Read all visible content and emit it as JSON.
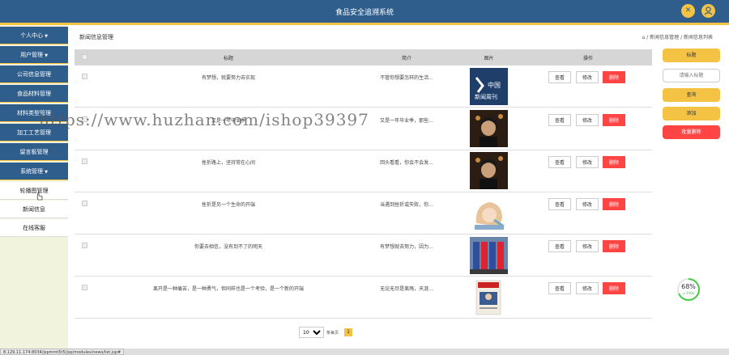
{
  "header": {
    "title": "食品安全追溯系统"
  },
  "sidebar": {
    "menu": [
      {
        "label": "个人中心",
        "caret": true
      },
      {
        "label": "用户管理",
        "caret": true
      },
      {
        "label": "公司信息管理",
        "caret": false
      },
      {
        "label": "食品材料管理",
        "caret": false
      },
      {
        "label": "材料类型管理",
        "caret": false
      },
      {
        "label": "加工工艺管理",
        "caret": false
      },
      {
        "label": "留言板管理",
        "caret": false
      },
      {
        "label": "系统管理",
        "caret": true
      }
    ],
    "submenu": [
      {
        "label": "轮播图管理"
      },
      {
        "label": "新闻信息"
      },
      {
        "label": "在线客服"
      }
    ]
  },
  "breadcrumb": {
    "page_title": "新闻信息管理",
    "path": "/ 新闻信息管理 / 新闻信息列表"
  },
  "table": {
    "columns": {
      "title": "标题",
      "intro": "简介",
      "image": "图片",
      "actions": "操作"
    },
    "rows": [
      {
        "title": "有梦想，就要努力去实现",
        "intro": "不管你想要怎样的生活...",
        "image": "magazine-cover"
      },
      {
        "title": "又是一年毕业季",
        "intro": "又是一年毕业季，那些...",
        "image": "portrait-dark"
      },
      {
        "title": "挫折路上，坚持常在心间",
        "intro": "回头看看，你会不会发...",
        "image": "portrait-dark"
      },
      {
        "title": "挫折是另一个生命的开端",
        "intro": "当遇到挫折或失败，你...",
        "image": "cartoon-girl"
      },
      {
        "title": "你要去相信，没有到不了的明天",
        "intro": "有梦想就去努力，因为...",
        "image": "flags"
      },
      {
        "title": "离开是一种痛苦，是一种勇气，但同样也是一个考验，是一个新的开端",
        "intro": "无论无尽是离殇，天涯...",
        "image": "book-cover"
      }
    ],
    "actions": {
      "view": "查看",
      "edit": "修改",
      "delete": "删除"
    }
  },
  "right_panel": {
    "title_button": "标题",
    "search_placeholder": "请输入标题",
    "query": "查询",
    "add": "添加",
    "batch_delete": "批量删除"
  },
  "pager": {
    "page_size": "10",
    "label": "条每页",
    "current_page": "1"
  },
  "progress": {
    "value": "68%",
    "sub": "↓ 0 K/s",
    "fraction": 0.68
  },
  "statusbar": {
    "url": "8.129.11.174:8034/jspmmt5t5/jsp/modules/news/list.jsp#"
  },
  "watermark": {
    "text": "https://www.huzhan.com/ishop39397"
  },
  "colors": {
    "primary": "#2f5e8c",
    "accent": "#f5c343",
    "danger": "#ff4444"
  }
}
